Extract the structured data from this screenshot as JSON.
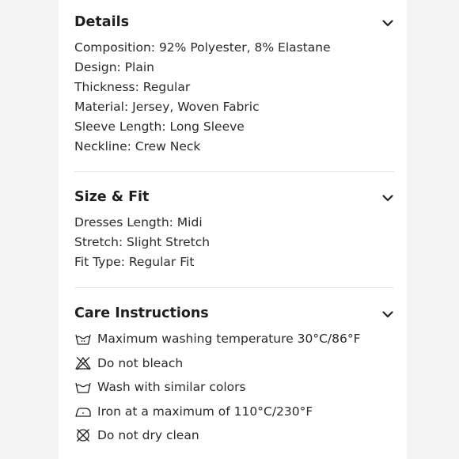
{
  "sections": {
    "details": {
      "title": "Details",
      "lines": [
        "Composition: 92% Polyester, 8% Elastane",
        "Design: Plain",
        "Thickness: Regular",
        "Material: Jersey, Woven Fabric",
        "Sleeve Length: Long Sleeve",
        "Neckline: Crew Neck"
      ]
    },
    "size_fit": {
      "title": "Size & Fit",
      "lines": [
        "Dresses Length: Midi",
        "Stretch: Slight Stretch",
        "Fit Type: Regular Fit"
      ]
    },
    "care": {
      "title": "Care Instructions",
      "items": [
        {
          "icon": "wash-30-icon",
          "text": "Maximum washing temperature 30°C/86°F"
        },
        {
          "icon": "no-bleach-icon",
          "text": "Do not bleach"
        },
        {
          "icon": "wash-tub-icon",
          "text": "Wash with similar colors"
        },
        {
          "icon": "iron-icon",
          "text": "Iron at a maximum of 110°C/230°F"
        },
        {
          "icon": "no-dry-clean-icon",
          "text": "Do not dry clean"
        }
      ]
    }
  }
}
